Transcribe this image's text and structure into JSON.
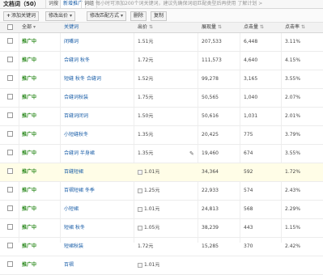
{
  "topbar": {
    "title": "文档词（50）",
    "tabs": [
      "词搜",
      "新增推广",
      "词组"
    ],
    "notice": "每小时可添加200个词关键词，建议先确保词组匹配类型后再使用    了解计划 >"
  },
  "toolbar": {
    "add_label": "添加关键词",
    "edit_bid_label": "修改出价",
    "match_type_label": "修改匹配方式",
    "delete_label": "删除",
    "copy_label": "复制"
  },
  "table": {
    "headers": [
      "全部",
      "关键词",
      "出价",
      "展现量",
      "点击量",
      "点击率"
    ],
    "rows": [
      {
        "status": "推广中",
        "keyword": "闭嘴词",
        "bid": "1.51元",
        "impressions": "207,533",
        "clicks": "6,448",
        "ctr": "3.11%",
        "edit": "",
        "bid_icon": false,
        "highlight": false
      },
      {
        "status": "推广中",
        "keyword": "合缝词 秋冬",
        "bid": "1.72元",
        "impressions": "111,573",
        "clicks": "4,640",
        "ctr": "4.15%",
        "edit": "",
        "bid_icon": false,
        "highlight": false
      },
      {
        "status": "推广中",
        "keyword": "短缝 秋冬 合缝词",
        "bid": "1.52元",
        "impressions": "99,278",
        "clicks": "3,165",
        "ctr": "3.55%",
        "edit": "",
        "bid_icon": false,
        "highlight": false
      },
      {
        "status": "推广中",
        "keyword": "合缝词秋装",
        "bid": "1.75元",
        "impressions": "50,565",
        "clicks": "1,040",
        "ctr": "2.07%",
        "edit": "",
        "bid_icon": false,
        "highlight": false
      },
      {
        "status": "推广中",
        "keyword": "百缝词闭词",
        "bid": "1.50元",
        "impressions": "50,616",
        "clicks": "1,031",
        "ctr": "2.01%",
        "edit": "",
        "bid_icon": false,
        "highlight": false
      },
      {
        "status": "推广中",
        "keyword": "小短缝秋冬",
        "bid": "1.35元",
        "impressions": "20,425",
        "clicks": "775",
        "ctr": "3.79%",
        "edit": "",
        "bid_icon": false,
        "highlight": false
      },
      {
        "status": "推广中",
        "keyword": "合缝词 半身裙",
        "bid": "1.35元",
        "impressions": "19,460",
        "clicks": "674",
        "ctr": "3.55%",
        "edit": "✎",
        "bid_icon": false,
        "highlight": false
      },
      {
        "status": "推广中",
        "keyword": "百缝短裙",
        "bid": "1.01元",
        "impressions": "34,364",
        "clicks": "592",
        "ctr": "1.72%",
        "edit": "",
        "bid_icon": true,
        "highlight": true
      },
      {
        "status": "推广中",
        "keyword": "百褶短裙 冬季",
        "bid": "1.25元",
        "impressions": "22,933",
        "clicks": "574",
        "ctr": "2.43%",
        "edit": "",
        "bid_icon": true,
        "highlight": false
      },
      {
        "status": "推广中",
        "keyword": "小短裙",
        "bid": "1.01元",
        "impressions": "24,813",
        "clicks": "568",
        "ctr": "2.29%",
        "edit": "",
        "bid_icon": true,
        "highlight": false
      },
      {
        "status": "推广中",
        "keyword": "短裙 秋冬",
        "bid": "1.05元",
        "impressions": "38,239",
        "clicks": "443",
        "ctr": "1.15%",
        "edit": "",
        "bid_icon": true,
        "highlight": false
      },
      {
        "status": "推广中",
        "keyword": "短裙秋装",
        "bid": "1.72元",
        "impressions": "15,285",
        "clicks": "370",
        "ctr": "2.42%",
        "edit": "",
        "bid_icon": false,
        "highlight": false
      },
      {
        "status": "推广中",
        "keyword": "百褶",
        "bid": "1.01元",
        "impressions": "",
        "clicks": "",
        "ctr": "",
        "edit": "",
        "bid_icon": true,
        "highlight": false
      }
    ]
  },
  "colors": {
    "status_green": "#2d8a1f",
    "keyword_blue": "#1a5ea8",
    "highlight_row": "#fffde7"
  }
}
